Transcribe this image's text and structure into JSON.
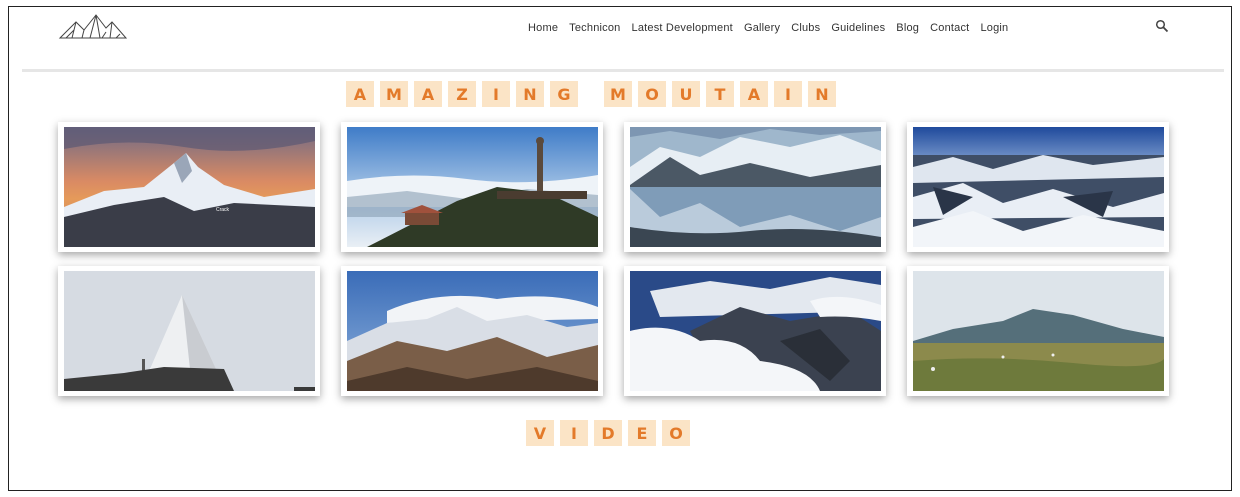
{
  "nav": {
    "items": [
      "Home",
      "Technicon",
      "Latest Development",
      "Gallery",
      "Clubs",
      "Guidelines",
      "Blog",
      "Contact",
      "Login"
    ],
    "search_icon": "search-icon",
    "logo_icon": "mountain-logo-icon"
  },
  "sections": {
    "gallery_title_words": [
      [
        "A",
        "M",
        "A",
        "Z",
        "I",
        "N",
        "G"
      ],
      [
        "M",
        "O",
        "U",
        "T",
        "A",
        "I",
        "N"
      ]
    ],
    "video_title_letters": [
      "V",
      "I",
      "D",
      "E",
      "O"
    ]
  },
  "gallery": {
    "images": [
      {
        "name": "sunset-snow-peak-image",
        "caption": "Crack"
      },
      {
        "name": "temple-peak-clouds-image"
      },
      {
        "name": "alpine-lake-reflection-image"
      },
      {
        "name": "snowy-range-aerial-image"
      },
      {
        "name": "summit-pyramid-marker-image"
      },
      {
        "name": "himalaya-panorama-image"
      },
      {
        "name": "cloud-peaks-aerial-image"
      },
      {
        "name": "green-meadow-mountain-image"
      }
    ]
  },
  "colors": {
    "title_letter_bg": "#fbe4c6",
    "title_letter_fg": "#e37a2a"
  }
}
